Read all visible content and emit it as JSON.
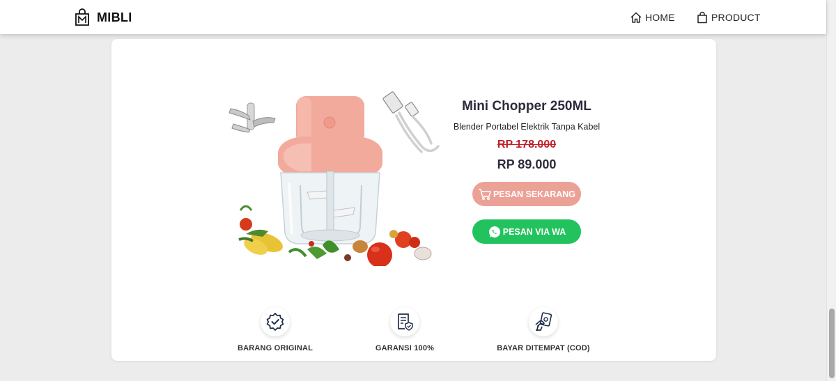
{
  "header": {
    "brand": "MIBLI",
    "nav": [
      {
        "label": "HOME",
        "icon": "home-icon"
      },
      {
        "label": "PRODUCT",
        "icon": "shopping-bag-icon"
      }
    ]
  },
  "product": {
    "title": "Mini Chopper 250ML",
    "subtitle": "Blender Portabel Elektrik Tanpa Kabel",
    "old_price": "RP 178.000",
    "price": "RP 89.000",
    "order_button": "PESAN SEKARANG",
    "wa_button": "PESAN VIA WA"
  },
  "features": [
    {
      "label": "BARANG ORIGINAL",
      "icon": "verified-badge-icon"
    },
    {
      "label": "GARANSI 100%",
      "icon": "warranty-document-icon"
    },
    {
      "label": "BAYAR DITEMPAT (COD)",
      "icon": "cash-payment-icon"
    }
  ],
  "colors": {
    "order_button": "#eca196",
    "wa_button": "#22c35e",
    "old_price": "#c0202a",
    "title": "#2b2b3b",
    "page_background": "#ececec",
    "icon_navy": "#1f2d4a"
  }
}
